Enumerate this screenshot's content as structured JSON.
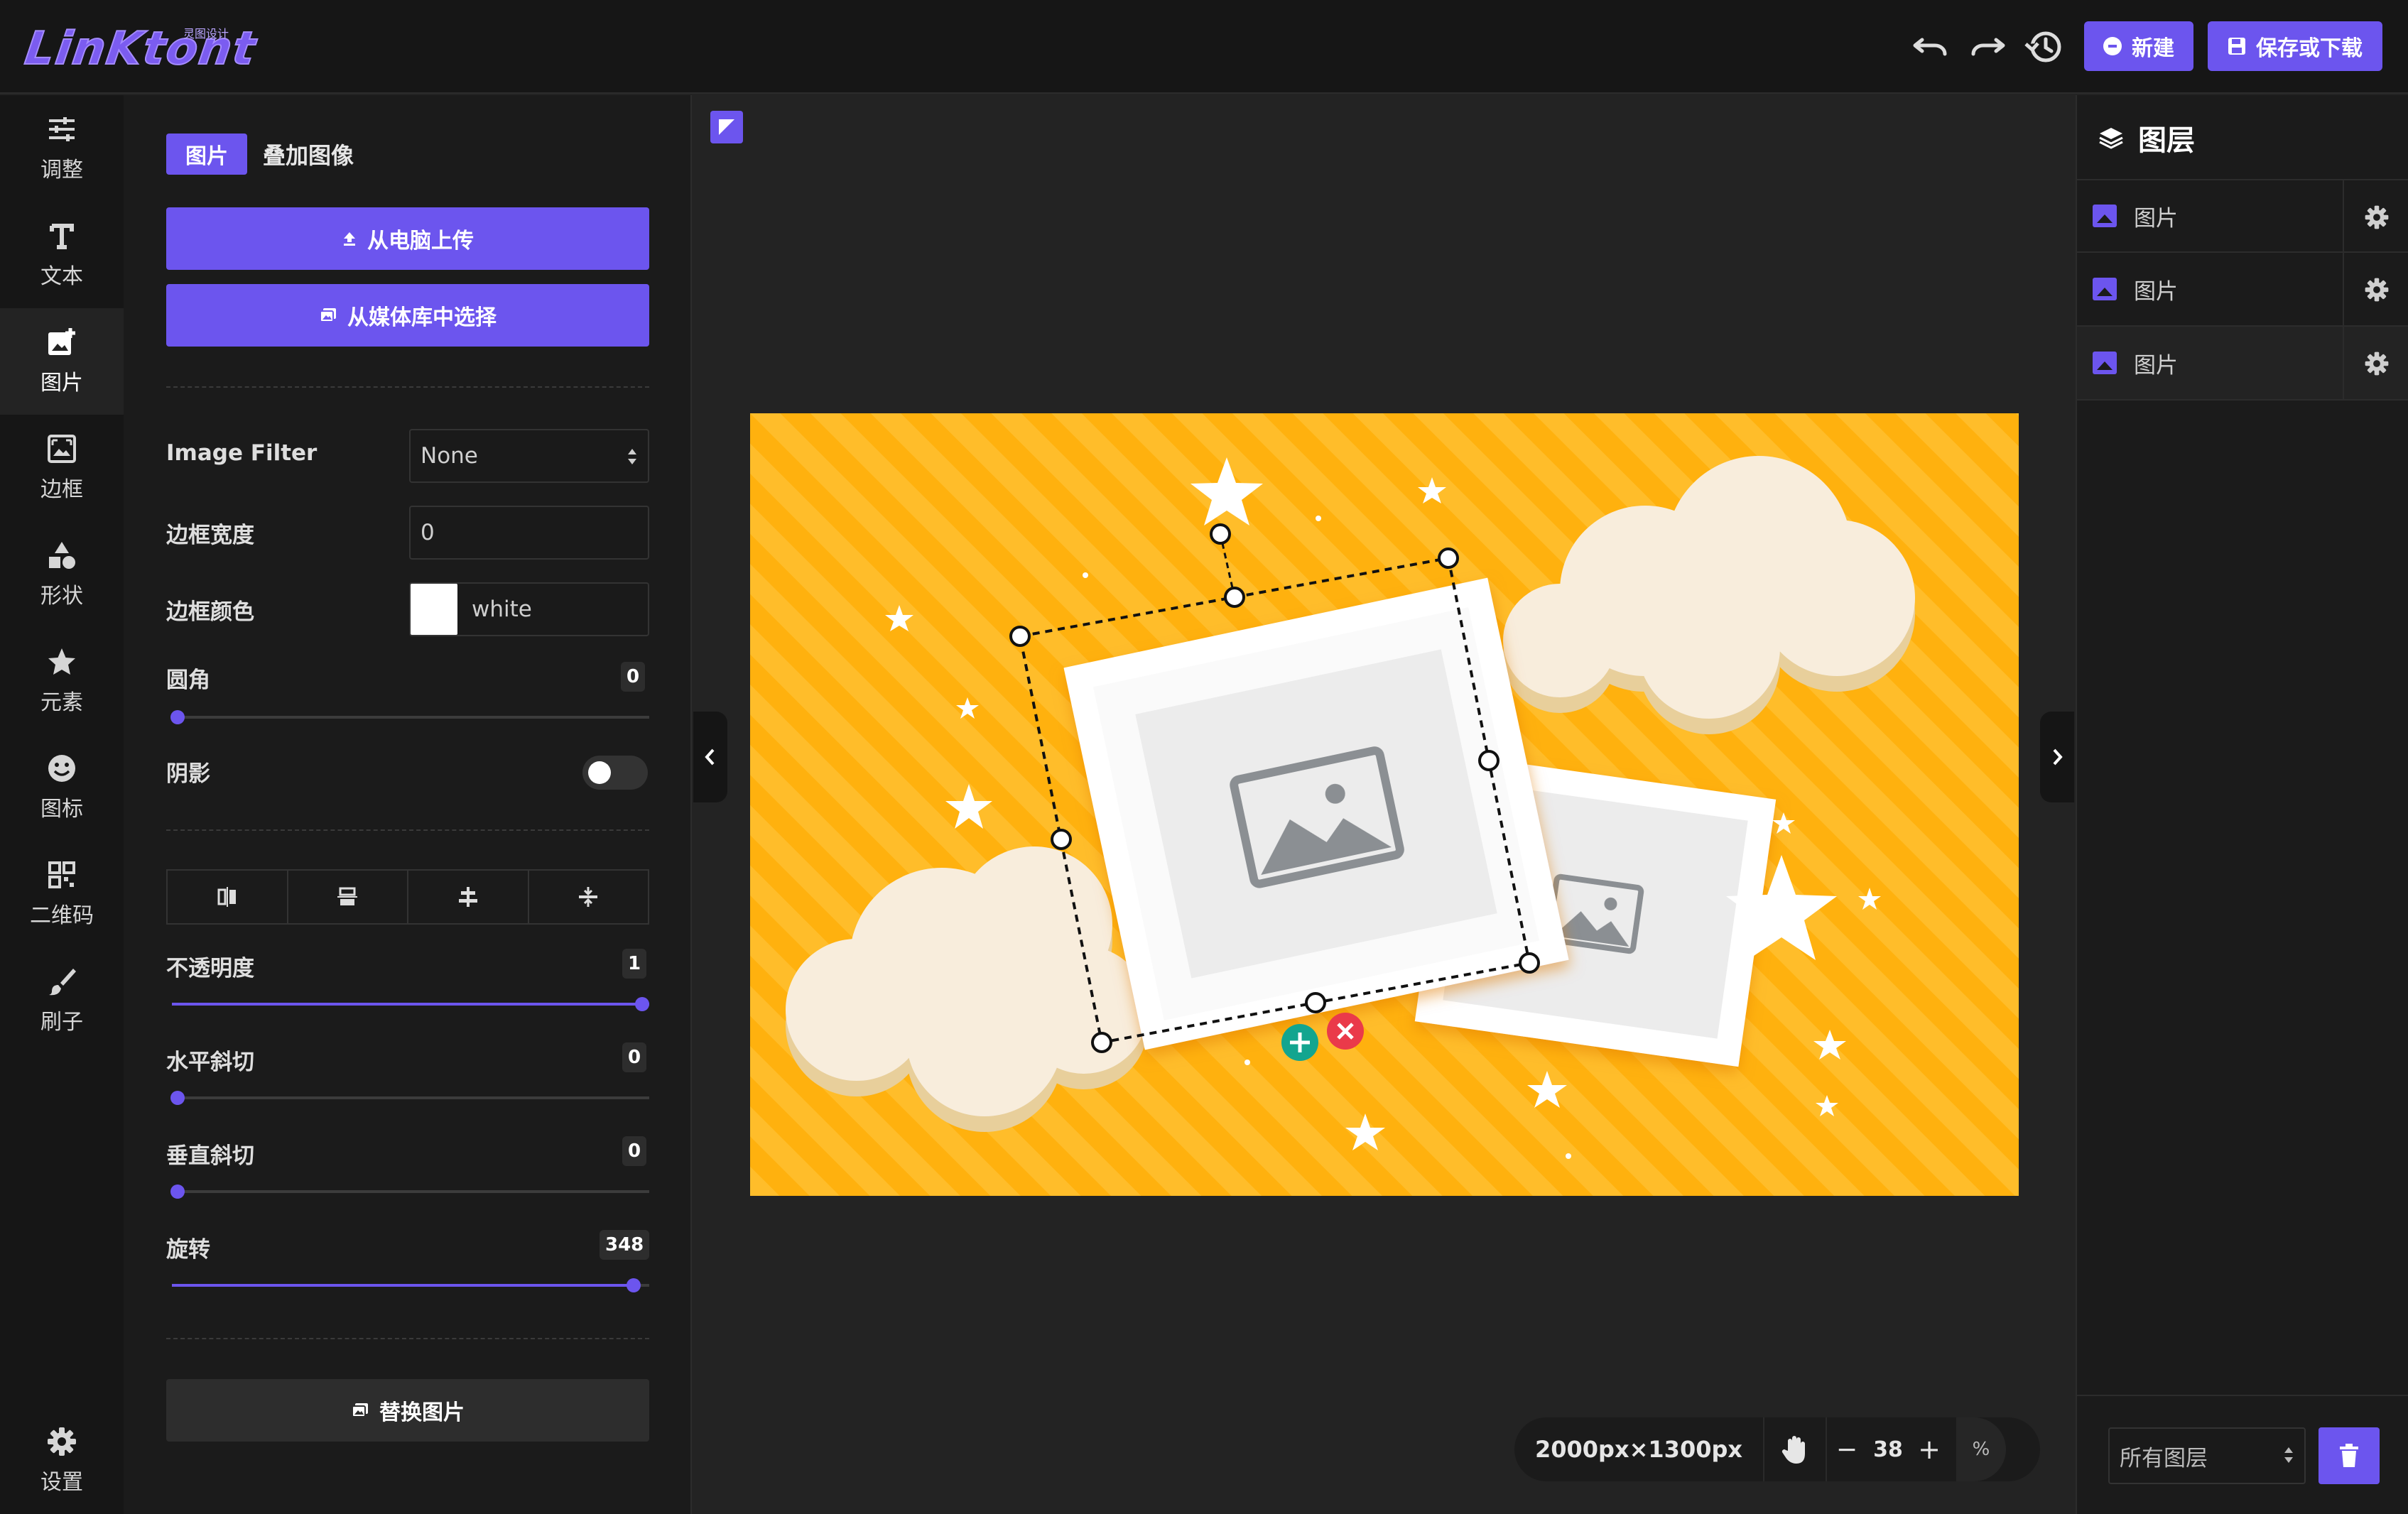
{
  "app": {
    "logo_text": "LinKtont",
    "logo_sub": "灵图设计"
  },
  "toolbar": {
    "undo_icon": "undo-icon",
    "redo_icon": "redo-icon",
    "history_icon": "history-icon",
    "new_label": "新建",
    "save_label": "保存或下载"
  },
  "rail": {
    "items": [
      {
        "label": "调整",
        "icon": "sliders-icon"
      },
      {
        "label": "文本",
        "icon": "text-icon"
      },
      {
        "label": "图片",
        "icon": "image-add-icon"
      },
      {
        "label": "边框",
        "icon": "frame-icon"
      },
      {
        "label": "形状",
        "icon": "shapes-icon"
      },
      {
        "label": "元素",
        "icon": "star-icon"
      },
      {
        "label": "图标",
        "icon": "smiley-icon"
      },
      {
        "label": "二维码",
        "icon": "qrcode-icon"
      },
      {
        "label": "刷子",
        "icon": "brush-icon"
      }
    ],
    "settings_label": "设置",
    "active": "图片"
  },
  "panel": {
    "tab_image": "图片",
    "tab_overlay": "叠加图像",
    "upload_label": "从电脑上传",
    "media_label": "从媒体库中选择",
    "filter_label": "Image Filter",
    "filter_value": "None",
    "border_width_label": "边框宽度",
    "border_width_value": "0",
    "border_color_label": "边框颜色",
    "border_color_value": "white",
    "radius_label": "圆角",
    "radius_value": "0",
    "shadow_label": "阴影",
    "shadow_on": false,
    "opacity_label": "不透明度",
    "opacity_value": "1",
    "skew_x_label": "水平斜切",
    "skew_x_value": "0",
    "skew_y_label": "垂直斜切",
    "skew_y_value": "0",
    "rotate_label": "旋转",
    "rotate_value": "348",
    "rotate_max": 360,
    "replace_label": "替换图片"
  },
  "canvas": {
    "dimensions": "2000px×1300px",
    "zoom": "38",
    "zoom_unit": "%",
    "minus": "−",
    "plus": "+"
  },
  "layers": {
    "title": "图层",
    "items": [
      "图片",
      "图片",
      "图片"
    ],
    "filter_value": "所有图层"
  },
  "colors": {
    "accent": "#6c55ee",
    "canvas_bg": "#ffb10e",
    "cloud": "#f8eddc"
  }
}
